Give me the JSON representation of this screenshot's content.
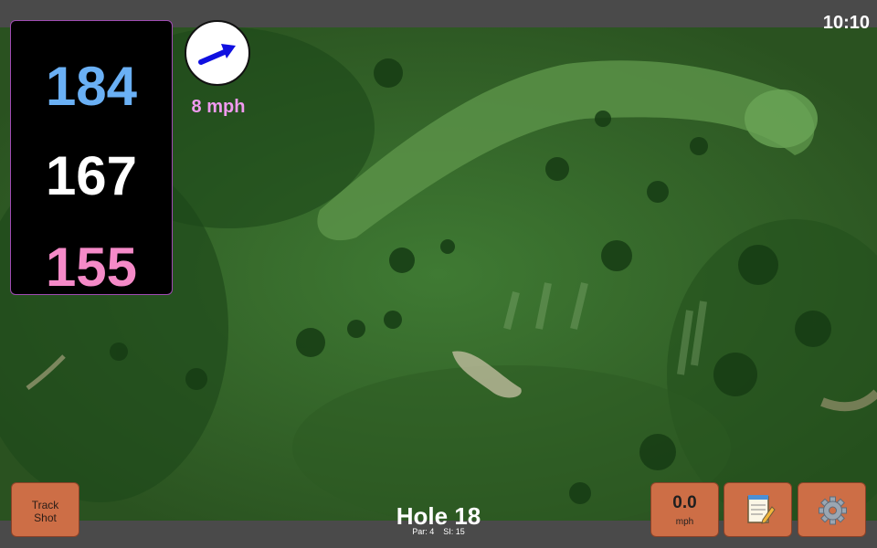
{
  "status": {
    "time": "10:10"
  },
  "distances": {
    "back": {
      "value": "184",
      "color": "#6ab0f5"
    },
    "middle": {
      "value": "167",
      "color": "#ffffff"
    },
    "front": {
      "value": "155",
      "color": "#f58ac8"
    }
  },
  "wind": {
    "speed_label": "8 mph",
    "arrow_color": "#1010e0",
    "label_color": "#f19af0"
  },
  "hole": {
    "title": "Hole 18",
    "par_label": "Par: 4",
    "si_label": "SI: 15"
  },
  "buttons": {
    "track_shot": {
      "line1": "Track",
      "line2": "Shot"
    },
    "speed": {
      "value": "0.0",
      "unit": "mph"
    },
    "notes": {
      "icon": "notepad-icon"
    },
    "settings": {
      "icon": "gear-icon"
    }
  },
  "colors": {
    "button_bg": "#cd6e46",
    "panel_border": "#a04cb3",
    "bar_bg": "#4a4a4a"
  }
}
